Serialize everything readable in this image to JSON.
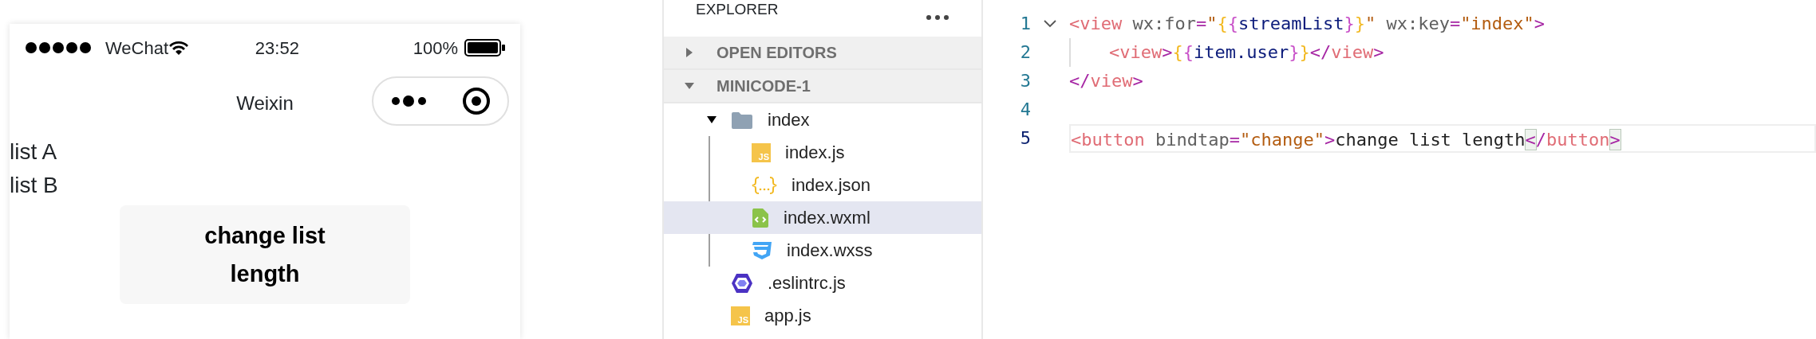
{
  "simulator": {
    "status_bar": {
      "carrier": "WeChat",
      "time": "23:52",
      "battery": "100%"
    },
    "nav_title": "Weixin",
    "content": {
      "list_items": [
        "list A",
        "list B"
      ],
      "button": "change list length"
    }
  },
  "explorer": {
    "title": "EXPLORER",
    "sections": [
      {
        "label": "OPEN EDITORS",
        "expanded": false
      },
      {
        "label": "MINICODE-1",
        "expanded": true,
        "children": [
          {
            "name": "index",
            "kind": "folder",
            "expanded": true,
            "selected": false,
            "children": [
              {
                "name": "index.js",
                "kind": "js",
                "badge": "JS",
                "selected": false
              },
              {
                "name": "index.json",
                "kind": "json",
                "selected": false
              },
              {
                "name": "index.wxml",
                "kind": "wxml",
                "selected": true
              },
              {
                "name": "index.wxss",
                "kind": "wxss",
                "selected": false
              }
            ]
          },
          {
            "name": ".eslintrc.js",
            "kind": "eslint",
            "selected": false
          },
          {
            "name": "app.js",
            "kind": "js",
            "badge": "JS",
            "selected": false
          }
        ]
      }
    ]
  },
  "editor": {
    "lines": [
      {
        "number": "1",
        "expanded": true,
        "current": false,
        "tokens": [
          {
            "text": "<",
            "kind": "tag"
          },
          {
            "text": "view",
            "kind": "tag"
          },
          {
            "text": " wx:for",
            "kind": "attr"
          },
          {
            "text": "=",
            "kind": "punct"
          },
          {
            "text": "\"",
            "kind": "string"
          },
          {
            "text": "{",
            "kind": "brace1"
          },
          {
            "text": "{",
            "kind": "brace2"
          },
          {
            "text": "streamList",
            "kind": "var"
          },
          {
            "text": "}",
            "kind": "brace2"
          },
          {
            "text": "}",
            "kind": "brace1"
          },
          {
            "text": "\"",
            "kind": "string"
          },
          {
            "text": " wx:key",
            "kind": "attr"
          },
          {
            "text": "=",
            "kind": "punct"
          },
          {
            "text": "\"index\"",
            "kind": "string"
          },
          {
            "text": ">",
            "kind": "punct"
          }
        ],
        "children": [
          {
            "number": "2",
            "current": false,
            "tokens": [
              {
                "text": "<",
                "kind": "tag"
              },
              {
                "text": "view",
                "kind": "tag"
              },
              {
                "text": ">",
                "kind": "punct"
              },
              {
                "text": "{",
                "kind": "brace1"
              },
              {
                "text": "{",
                "kind": "brace2"
              },
              {
                "text": "item.user",
                "kind": "var"
              },
              {
                "text": "}",
                "kind": "brace2"
              },
              {
                "text": "}",
                "kind": "brace1"
              },
              {
                "text": "</",
                "kind": "punct"
              },
              {
                "text": "view",
                "kind": "tag"
              },
              {
                "text": ">",
                "kind": "punct"
              }
            ]
          }
        ]
      },
      {
        "number": "3",
        "current": false,
        "tokens": [
          {
            "text": "</",
            "kind": "punct"
          },
          {
            "text": "view",
            "kind": "tag"
          },
          {
            "text": ">",
            "kind": "punct"
          }
        ]
      },
      {
        "number": "4",
        "current": false
      },
      {
        "number": "5",
        "current": true,
        "tokens": [
          {
            "text": "<",
            "kind": "tag"
          },
          {
            "text": "button",
            "kind": "tag"
          },
          {
            "text": " bindtap",
            "kind": "attr"
          },
          {
            "text": "=",
            "kind": "punct"
          },
          {
            "text": "\"change\"",
            "kind": "string"
          },
          {
            "text": ">",
            "kind": "punct"
          },
          {
            "text": "change list length",
            "kind": "text"
          },
          {
            "text": "<",
            "kind": "punct",
            "matched": true
          },
          {
            "text": "/",
            "kind": "punct"
          },
          {
            "text": "button",
            "kind": "tag"
          },
          {
            "text": ">",
            "kind": "punct",
            "matched": true
          }
        ]
      }
    ]
  }
}
